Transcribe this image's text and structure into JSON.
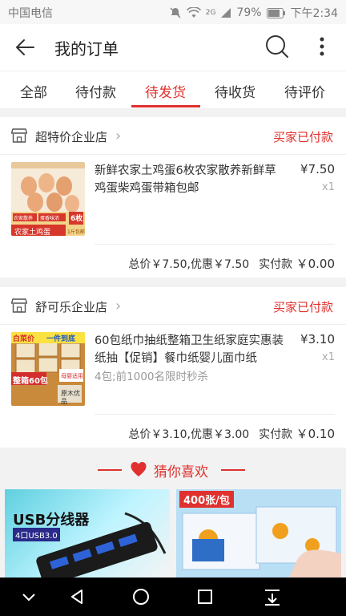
{
  "status_bar": {
    "carrier": "中国电信",
    "network": "2G",
    "battery": "79%",
    "time": "下午2:34"
  },
  "header": {
    "title": "我的订单"
  },
  "tabs": [
    {
      "label": "全部"
    },
    {
      "label": "待付款"
    },
    {
      "label": "待发货",
      "active": true
    },
    {
      "label": "待收货"
    },
    {
      "label": "待评价"
    }
  ],
  "orders": [
    {
      "shop": "超特价企业店",
      "status": "买家已付款",
      "product": {
        "title": "新鲜农家土鸡蛋6枚农家散养新鲜草鸡蛋柴鸡蛋带箱包邮",
        "subtitle": "",
        "price": "¥7.50",
        "qty": "x1",
        "thumb_labels": [
          "农家散养",
          "蛋香味浓",
          "6枚",
          "农家土鸡蛋",
          "1斤包邮"
        ]
      },
      "summary": {
        "total_text": "总价￥7.50,优惠￥7.50",
        "pay_label": "实付款",
        "pay_value": "￥0.00"
      }
    },
    {
      "shop": "舒可乐企业店",
      "status": "买家已付款",
      "product": {
        "title": "60包纸巾抽纸整箱卫生纸家庭实惠装纸抽【促销】餐巾纸婴儿面巾纸",
        "subtitle": "4包;前1000名限时秒杀",
        "price": "¥3.10",
        "qty": "x1",
        "thumb_labels": [
          "白菜价",
          "一件到底",
          "整箱60包",
          "母婴适用",
          "原木优品"
        ]
      },
      "summary": {
        "total_text": "总价￥3.10,优惠￥3.00",
        "pay_label": "实付款",
        "pay_value": "￥0.10"
      }
    }
  ],
  "guess": {
    "title": "猜你喜欢"
  },
  "recommend": [
    {
      "title": "USB分线器",
      "subtitle": "4口USB3.0"
    },
    {
      "badge": "400张/包"
    }
  ],
  "colors": {
    "accent": "#e0312e",
    "text": "#333333",
    "muted": "#999999"
  }
}
